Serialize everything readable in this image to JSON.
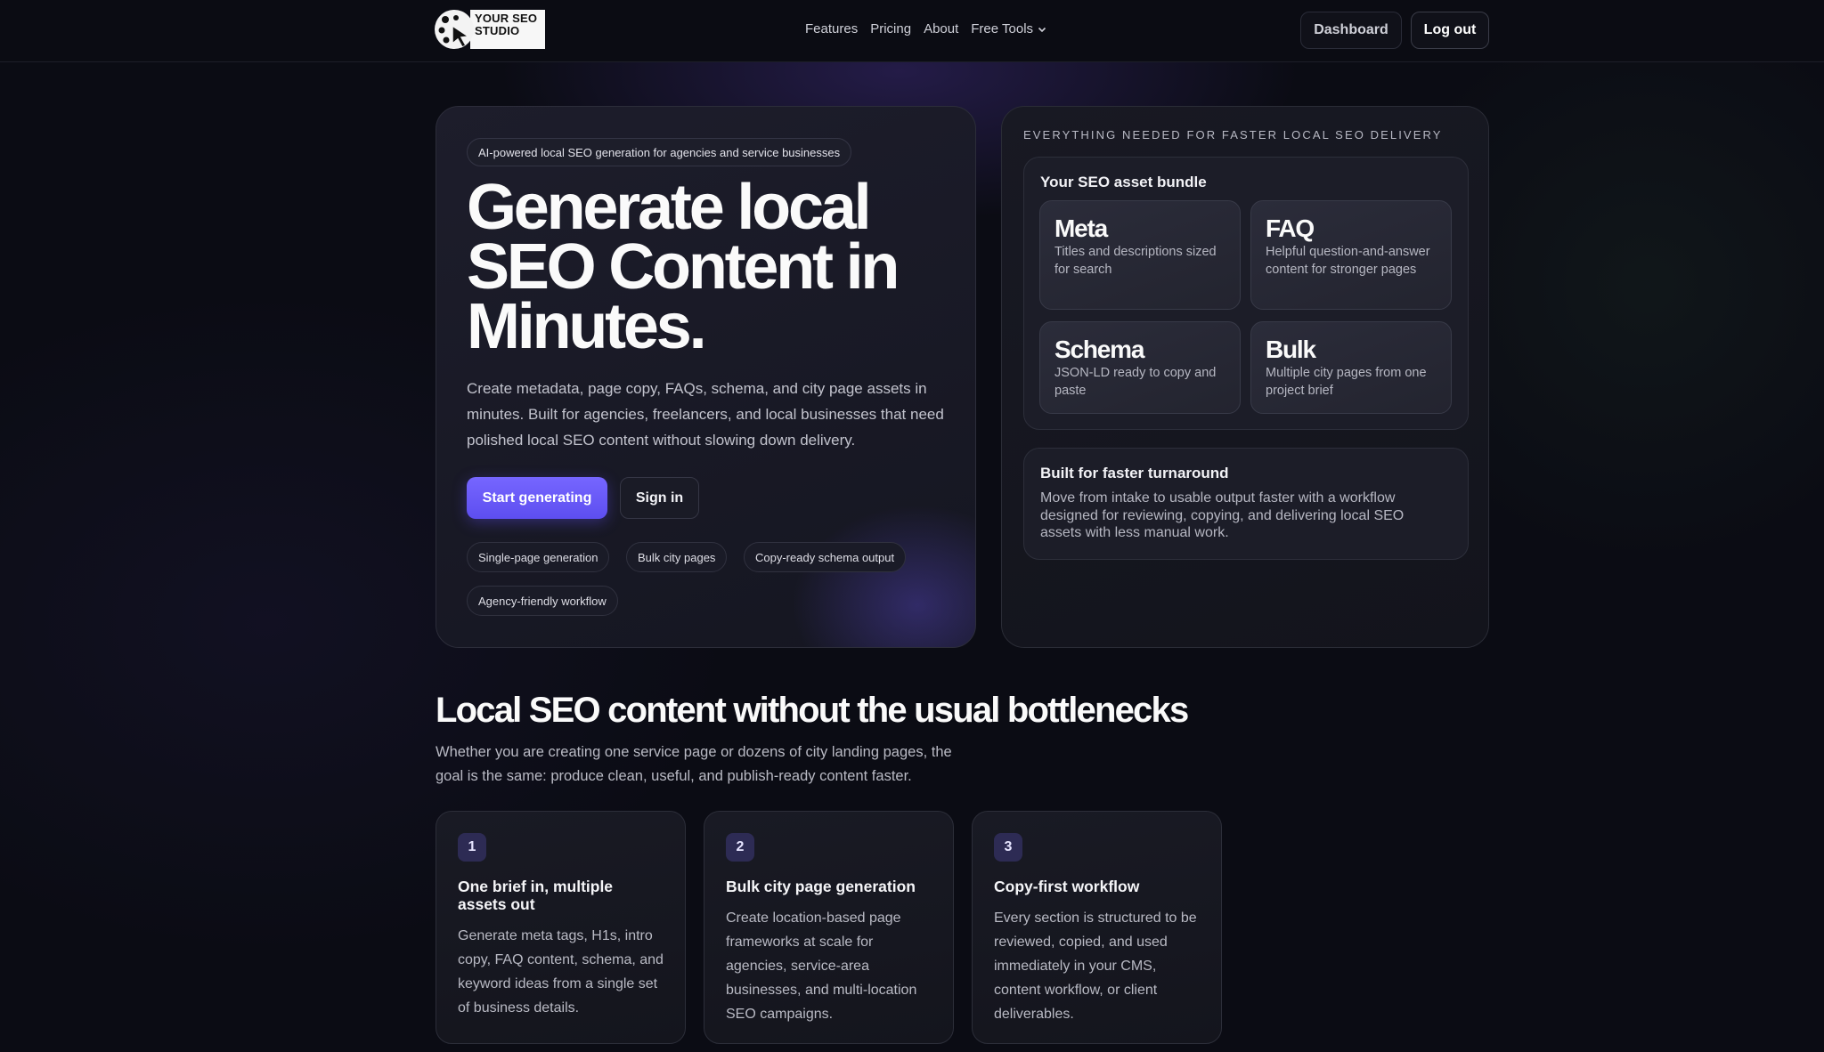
{
  "nav": {
    "logo_text": "YOUR SEO STUDIO",
    "links": [
      "Features",
      "Pricing",
      "About",
      "Free Tools"
    ],
    "dashboard": "Dashboard",
    "logout": "Log out"
  },
  "hero": {
    "badge": "AI-powered local SEO generation for agencies and service businesses",
    "title": "Generate local SEO Content in Minutes.",
    "description": "Create metadata, page copy, FAQs, schema, and city page assets in minutes. Built for agencies, freelancers, and local businesses that need polished local SEO content without slowing down delivery.",
    "primary_cta": "Start generating",
    "secondary_cta": "Sign in",
    "tags": [
      "Single-page generation",
      "Bulk city pages",
      "Copy-ready schema output",
      "Agency-friendly workflow"
    ]
  },
  "panel": {
    "eyebrow": "EVERYTHING NEEDED FOR FASTER LOCAL SEO DELIVERY",
    "bundle_title": "Your SEO asset bundle",
    "assets": [
      {
        "name": "Meta",
        "desc": "Titles and descriptions sized for search"
      },
      {
        "name": "FAQ",
        "desc": "Helpful question-and-answer content for stronger pages"
      },
      {
        "name": "Schema",
        "desc": "JSON-LD ready to copy and paste"
      },
      {
        "name": "Bulk",
        "desc": "Multiple city pages from one project brief"
      }
    ],
    "turnaround_title": "Built for faster turnaround",
    "turnaround_text": "Move from intake to usable output faster with a workflow designed for reviewing, copying, and delivering local SEO assets with less manual work."
  },
  "section": {
    "title": "Local SEO content without the usual bottlenecks",
    "description": "Whether you are creating one service page or dozens of city landing pages, the goal is the same: produce clean, useful, and publish-ready content faster.",
    "features": [
      {
        "num": "1",
        "title": "One brief in, multiple assets out",
        "text": "Generate meta tags, H1s, intro copy, FAQ content, schema, and keyword ideas from a single set of business details."
      },
      {
        "num": "2",
        "title": "Bulk city page generation",
        "text": "Create location-based page frameworks at scale for agencies, service-area businesses, and multi-location SEO campaigns."
      },
      {
        "num": "3",
        "title": "Copy-first workflow",
        "text": "Every section is structured to be reviewed, copied, and used immediately in your CMS, content workflow, or client deliverables."
      }
    ]
  }
}
